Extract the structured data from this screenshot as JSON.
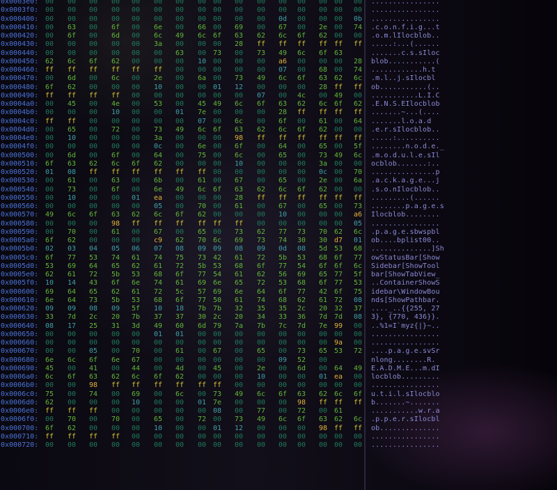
{
  "colors": {
    "background": "#06040d",
    "address": "#4a74d8",
    "zero_byte": "#1f7a5a",
    "printable_byte": "#62b83a",
    "control_byte": "#3fa1a8",
    "high_byte": "#e2b43a",
    "ff_byte": "#d4c838",
    "ascii_text": "#8b8bd6"
  },
  "hexdump": {
    "rows": [
      {
        "a": "0x0003e0:",
        "h": "00 00 00 00 00 00 00 00 00 00 00 00 00 00 00 00",
        "t": "................"
      },
      {
        "a": "0x0003f0:",
        "h": "00 00 00 00 00 00 00 00 00 00 00 00 00 00 00 00",
        "t": "................"
      },
      {
        "a": "0x000400:",
        "h": "00 00 00 00 00 00 00 00 00 00 00 0d 00 00 00 0b",
        "t": "................"
      },
      {
        "a": "0x000410:",
        "h": "00 63 00 6f 00 6e 00 66 00 69 00 67 00 2e 00 74",
        "t": ".c.o.n.f.i.g...t"
      },
      {
        "a": "0x000420:",
        "h": "00 6f 00 6d 00 6c 49 6c 6f 63 62 6c 6f 62 00 00",
        "t": ".o.m.lIlocblob.."
      },
      {
        "a": "0x000430:",
        "h": "00 00 00 00 00 3a 00 00 00 28 ff ff ff ff ff ff",
        "t": ".....:...(......"
      },
      {
        "a": "0x000440:",
        "h": "00 00 00 00 00 00 63 00 73 00 73 49 6c 6f 63",
        "t": ".......c.s.sIloc"
      },
      {
        "a": "0x000450:",
        "h": "62 6c 6f 62 00 00 00 10 00 00 00 a6 00 00 00 28",
        "t": "blob...........("
      },
      {
        "a": "0x000460:",
        "h": "ff ff ff ff ff ff 00 00 00 00 00 07 00 68 00 74",
        "t": "............h.t"
      },
      {
        "a": "0x000470:",
        "h": "00 6d 00 6c 00 2e 00 6a 00 73 49 6c 6f 63 62 6c",
        "t": ".m.l..j.sIlocbl"
      },
      {
        "a": "0x000480:",
        "h": "6f 62 00 00 00 10 00 00 01 12 00 00 00 28 ff ff",
        "t": "ob...........(.."
      },
      {
        "a": "0x000490:",
        "h": "ff ff ff ff 00 00 00 00 00 00 07 00 4c 00 49 00 43",
        "t": "...........L.I.C"
      },
      {
        "a": "0x0004a0:",
        "h": "00 45 00 4e 00 53 00 45 49 6c 6f 63 62 6c 6f 62",
        "t": ".E.N.S.EIlocblob"
      },
      {
        "a": "0x0004b0:",
        "h": "00 00 00 10 00 00 01 7e 00 00 00 28 ff ff ff ff",
        "t": ".......~...(...."
      },
      {
        "a": "0x0004c0:",
        "h": "ff ff 00 00 00 00 00 07 00 6c 00 6f 00 61 00 64",
        "t": ".......l.o.a.d"
      },
      {
        "a": "0x0004d0:",
        "h": "00 65 00 72 00 73 49 6c 6f 63 62 6c 6f 62 00 00",
        "t": ".e.r.sIlocblob.."
      },
      {
        "a": "0x0004e0:",
        "h": "00 10 00 00 00 3a 00 00 00 98 ff ff ff ff ff ff",
        "t": ".....:.........."
      },
      {
        "a": "0x0004f0:",
        "h": "00 00 00 00 00 0c 00 6e 00 6f 00 64 00 65 00 5f",
        "t": "........n.o.d.e._"
      },
      {
        "a": "0x000500:",
        "h": "00 6d 00 6f 00 64 00 75 00 6c 00 65 00 73 49 6c",
        "t": ".m.o.d.u.l.e.sIl"
      },
      {
        "a": "0x000510:",
        "h": "6f 63 62 6c 6f 62 00 00 00 10 00 00 00 3a 00 00",
        "t": "ocblob.......:.."
      },
      {
        "a": "0x000520:",
        "h": "01 08 ff ff ff ff ff ff 00 00 00 00 00 0c 00 70",
        "t": "...............p"
      },
      {
        "a": "0x000530:",
        "h": "00 61 00 63 00 6b 00 61 00 67 00 65 00 2e 00 6a",
        "t": ".a.c.k.a.g.e...j"
      },
      {
        "a": "0x000540:",
        "h": "00 73 00 6f 00 6e 49 6c 6f 63 62 6c 6f 62 00 00",
        "t": ".s.o.nIlocblob.."
      },
      {
        "a": "0x000550:",
        "h": "00 10 00 00 01 ea 00 00 00 28 ff ff ff ff ff ff",
        "t": ".........(......"
      },
      {
        "a": "0x000560:",
        "h": "00 00 00 00 00 05 00 70 00 61 00 67 00 65 00 73",
        "t": "........p.a.g.e.s"
      },
      {
        "a": "0x000570:",
        "h": "49 6c 6f 63 62 6c 6f 62 00 00 00 10 00 00 00 a6",
        "t": "Ilocblob........"
      },
      {
        "a": "0x000580:",
        "h": "00 00 00 98 ff ff ff ff ff ff 00 00 00 00 00 05",
        "t": "................"
      },
      {
        "a": "0x000590:",
        "h": "00 70 00 61 00 67 00 65 00 73 62 77 73 70 62 6c",
        "t": ".p.a.g.e.sbwspbl"
      },
      {
        "a": "0x0005a0:",
        "h": "6f 62 00 00 00 c9 62 70 6c 69 73 74 30 30 d7 01",
        "t": "ob....bplist00.."
      },
      {
        "a": "0x0005b0:",
        "h": "02 03 04 05 06 07 08 09 09 08 09 0d 08 5d 53 68",
        "t": "..............]Sh"
      },
      {
        "a": "0x0005c0:",
        "h": "6f 77 53 74 61 74 75 73 42 61 72 5b 53 68 6f 77",
        "t": "owStatusBar[Show"
      },
      {
        "a": "0x0005d0:",
        "h": "53 69 64 65 62 61 72 5b 53 68 6f 77 54 6f 6f 6c",
        "t": "Sidebar[ShowTool"
      },
      {
        "a": "0x0005e0:",
        "h": "62 61 72 5b 53 68 6f 77 54 61 62 56 69 65 77 5f",
        "t": "bar[ShowTabView_"
      },
      {
        "a": "0x0005f0:",
        "h": "10 14 43 6f 6e 74 61 69 6e 65 72 53 68 6f 77 53",
        "t": "..ContainerShowS"
      },
      {
        "a": "0x000600:",
        "h": "69 64 65 62 61 72 5c 57 69 6e 64 6f 77 42 6f 75",
        "t": "idebar\\WindowBou"
      },
      {
        "a": "0x000610:",
        "h": "6e 64 73 5b 53 68 6f 77 50 61 74 68 62 61 72 08",
        "t": "nds[ShowPathbar."
      },
      {
        "a": "0x000620:",
        "h": "09 09 08 09 5f 10 18 7b 7b 32 35 35 2c 20 32 37",
        "t": "...._..{{255, 27"
      },
      {
        "a": "0x000630:",
        "h": "33 7d 2c 20 7b 37 37 30 2c 20 34 33 36 7d 7d 08",
        "t": "3}, {770, 436}}."
      },
      {
        "a": "0x000640:",
        "h": "08 17 25 31 3d 49 60 6d 79 7a 7b 7c 7d 7e 99 00",
        "t": "..%1=I`myz{|}~.."
      },
      {
        "a": "0x000650:",
        "h": "00 00 00 00 00 01 01 00 00 00 00 00 00 00 00 00",
        "t": "................"
      },
      {
        "a": "0x000660:",
        "h": "00 00 00 00 00 00 00 00 00 00 00 00 00 00 9a 00",
        "t": "................"
      },
      {
        "a": "0x000670:",
        "h": "00 00 05 00 70 00 61 00 67 00 65 00 73 65 53 72",
        "t": "....p.a.g.e.svSr"
      },
      {
        "a": "0x000680:",
        "h": "6e 6c 6f 6e 67 00 00 00 00 00 00 09 52 00",
        "t": "nlong........R."
      },
      {
        "a": "0x000690:",
        "h": "45 00 41 00 44 00 4d 00 45 00 2e 00 6d 00 64 49",
        "t": "E.A.D.M.E...m.dI"
      },
      {
        "a": "0x0006a0:",
        "h": "6c 6f 63 62 6c 6f 62 00 00 00 10 00 00 01 ea 00",
        "t": "locblob........."
      },
      {
        "a": "0x0006b0:",
        "h": "00 00 98 ff ff ff ff ff ff 00 00 00 00 00 00 00",
        "t": "................"
      },
      {
        "a": "0x0006c0:",
        "h": "75 00 74 00 69 00 6c 00 73 49 6c 6f 63 62 6c 6f",
        "t": "u.t.i.l.sIlocblo"
      },
      {
        "a": "0x0006d0:",
        "h": "62 00 00 00 10 00 00 01 7e 00 00 00 98 ff ff ff",
        "t": "b.......~......."
      },
      {
        "a": "0x0006e0:",
        "h": "ff ff ff 00 00 00 00 00 08 00 77 00 72 00 61",
        "t": "...........w.r.a"
      },
      {
        "a": "0x0006f0:",
        "h": "00 70 00 70 00 65 00 72 00 73 49 6c 6f 63 62 6c",
        "t": ".p.p.e.r.sIlocbl"
      },
      {
        "a": "0x000700:",
        "h": "6f 62 00 00 00 10 00 00 01 12 00 00 00 98 ff ff",
        "t": "ob.............."
      },
      {
        "a": "0x000710:",
        "h": "ff ff ff ff 00 00 00 00 00 00 00 00 00 00 00 00",
        "t": "................"
      },
      {
        "a": "0x000720:",
        "h": "00 00 00 00 00 00 00 00 00 00 00 00 00 00 00 00",
        "t": "................"
      }
    ]
  }
}
